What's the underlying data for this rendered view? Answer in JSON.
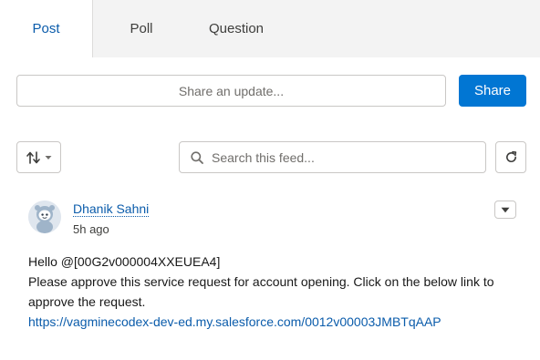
{
  "publisher": {
    "tabs": [
      {
        "label": "Post",
        "active": true
      },
      {
        "label": "Poll",
        "active": false
      },
      {
        "label": "Question",
        "active": false
      }
    ],
    "update_placeholder": "Share an update...",
    "share_label": "Share"
  },
  "feed_controls": {
    "sort_icon": "sort-arrows-icon",
    "search_placeholder": "Search this feed...",
    "refresh_icon": "refresh-icon"
  },
  "feed_item": {
    "author": "Dhanik Sahni",
    "timestamp": "5h ago",
    "avatar_icon": "user-avatar-icon",
    "body_lines": [
      "Hello @[00G2v000004XXEUEA4]",
      "Please approve this service request for account opening. Click on the below link to",
      "approve the request."
    ],
    "link": "https://vagminecodex-dev-ed.my.salesforce.com/0012v00003JMBTqAAP"
  },
  "colors": {
    "accent": "#0176d3",
    "link": "#0b5cab",
    "panel_bg": "#f3f3f3",
    "border": "#c9c7c5"
  }
}
